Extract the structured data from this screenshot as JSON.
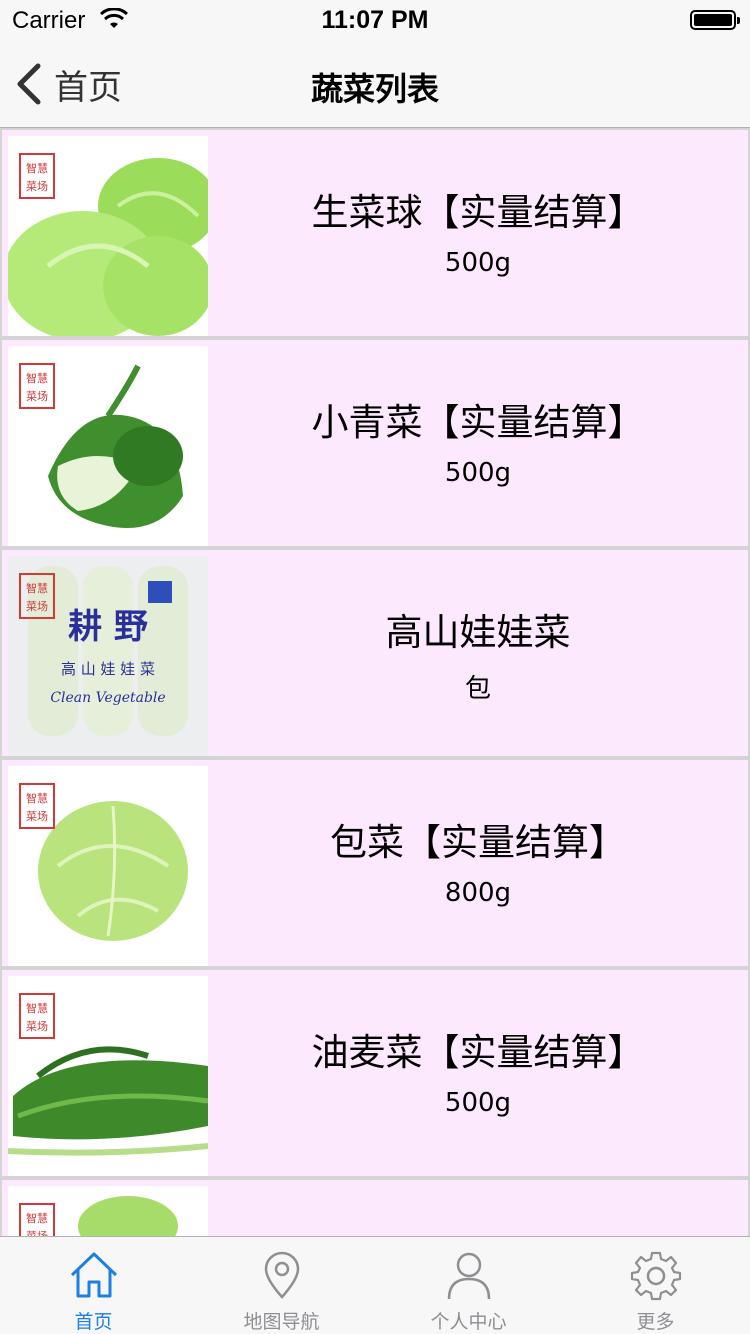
{
  "status_bar": {
    "carrier": "Carrier",
    "time": "11:07 PM"
  },
  "nav": {
    "back_label": "首页",
    "title": "蔬菜列表"
  },
  "items": [
    {
      "name": "生菜球【实量结算】",
      "unit": "500g",
      "image": "lettuce-image"
    },
    {
      "name": "小青菜【实量结算】",
      "unit": "500g",
      "image": "bok-choy-image"
    },
    {
      "name": "高山娃娃菜",
      "unit": "包",
      "image": "baby-cabbage-package-image"
    },
    {
      "name": "包菜【实量结算】",
      "unit": "800g",
      "image": "cabbage-image"
    },
    {
      "name": "油麦菜【实量结算】",
      "unit": "500g",
      "image": "indian-lettuce-image"
    },
    {
      "name": "",
      "unit": "",
      "image": "leafy-vegetable-image"
    }
  ],
  "tabs": [
    {
      "label": "首页",
      "icon": "home-icon",
      "active": true
    },
    {
      "label": "地图导航",
      "icon": "location-pin-icon",
      "active": false
    },
    {
      "label": "个人中心",
      "icon": "person-icon",
      "active": false
    },
    {
      "label": "更多",
      "icon": "gear-icon",
      "active": false
    }
  ],
  "colors": {
    "accent": "#1d7fe0",
    "row_background": "#fde9fd",
    "inactive_tab": "#8e8e93"
  }
}
